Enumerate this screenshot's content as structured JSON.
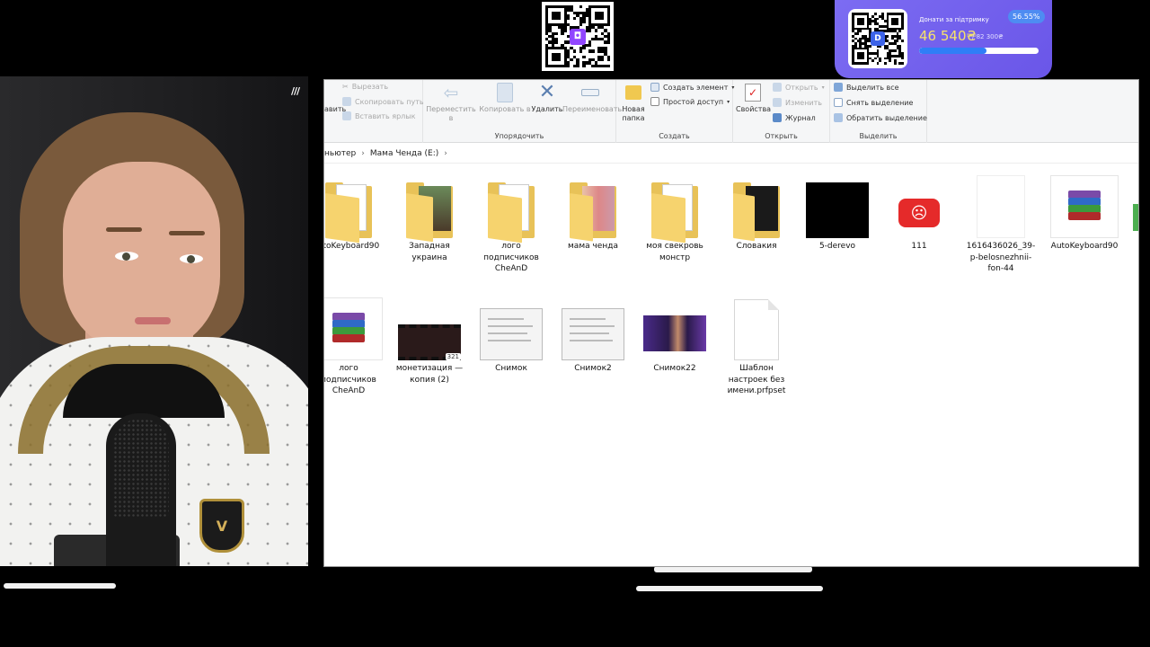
{
  "overlay": {
    "donation": {
      "title": "Донати за підтримку",
      "amount": "46 540₴",
      "goal": "/ 82 300₴",
      "percent": "56.55%",
      "progress": 0.5655,
      "accent": "#6c5ce7"
    },
    "webcam_mark": "///"
  },
  "explorer": {
    "ribbon": {
      "clipboard": {
        "cut": "Вырезать",
        "copy_path": "Скопировать путь",
        "paste_shortcut": "Вставить ярлык",
        "partial": "авить"
      },
      "organize": {
        "title": "Упорядочить",
        "move": "Переместить в",
        "copy": "Копировать в",
        "delete": "Удалить",
        "rename": "Переименовать"
      },
      "create": {
        "title": "Создать",
        "new_folder": "Новая папка",
        "new_item": "Создать элемент",
        "easy_access": "Простой доступ"
      },
      "open": {
        "title": "Открыть",
        "properties": "Свойства",
        "open": "Открыть",
        "edit": "Изменить",
        "history": "Журнал"
      },
      "select": {
        "title": "Выделить",
        "select_all": "Выделить все",
        "select_none": "Снять выделение",
        "invert": "Обратить выделение"
      }
    },
    "address": {
      "crumbs": [
        "ньютер",
        "Мама Ченда (E:)"
      ]
    },
    "items_row1": [
      {
        "name": "utoKeyboard90",
        "kind": "folder-doc"
      },
      {
        "name": "Западная украина",
        "kind": "folder-photo"
      },
      {
        "name": "лого подписчиков CheAnD",
        "kind": "folder-plain"
      },
      {
        "name": "мама ченда",
        "kind": "folder-faces"
      },
      {
        "name": "моя свекровь монстр",
        "kind": "folder-doc"
      },
      {
        "name": "Словакия",
        "kind": "folder-dark"
      },
      {
        "name": "5-derevo",
        "kind": "black-image"
      },
      {
        "name": "111",
        "kind": "red-image"
      },
      {
        "name": "1616436026_39-p-belosnezhnii-fon-44",
        "kind": "white-image"
      },
      {
        "name": "AutoKeyboard90",
        "kind": "rar"
      }
    ],
    "items_row2": [
      {
        "name": "лого подписчиков CheAnD",
        "kind": "rar"
      },
      {
        "name": "монетизация — копия (2)",
        "kind": "video"
      },
      {
        "name": "Снимок",
        "kind": "screenshot"
      },
      {
        "name": "Снимок2",
        "kind": "screenshot"
      },
      {
        "name": "Снимок22",
        "kind": "purple-shot"
      },
      {
        "name": "Шаблон настроек без имени.prfpset",
        "kind": "doc"
      }
    ],
    "video_badge": "321"
  }
}
